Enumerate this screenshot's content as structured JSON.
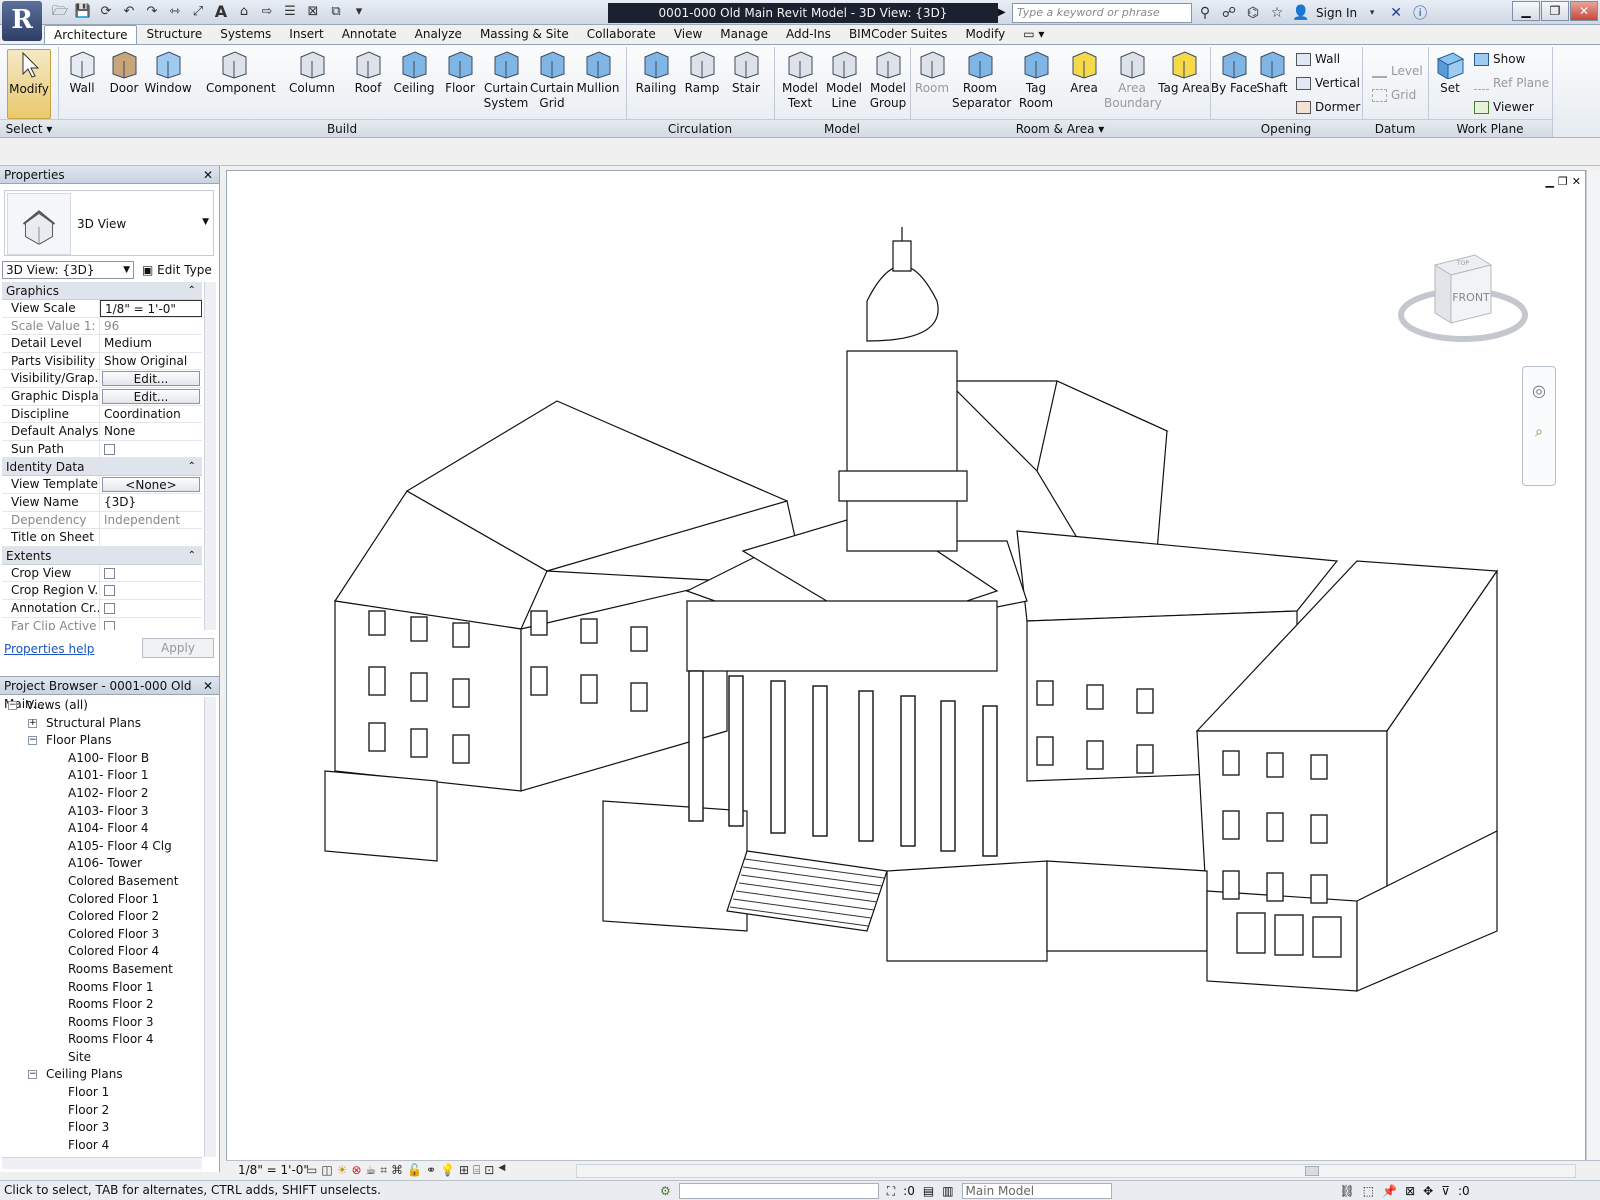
{
  "app": {
    "logo": "R",
    "document_title": "0001-000 Old Main Revit Model - 3D View: {3D}"
  },
  "quick_access": [
    "open-icon",
    "save-icon",
    "sync-icon",
    "undo-icon",
    "redo-icon",
    "measure-icon",
    "dimension-icon",
    "text-icon",
    "3d-view-icon",
    "section-icon",
    "thin-lines-icon",
    "close-hidden-icon",
    "switch-windows-icon"
  ],
  "infocenter": {
    "search_placeholder": "Type a keyword or phrase",
    "sign_in": "Sign In"
  },
  "tabs": [
    "Architecture",
    "Structure",
    "Systems",
    "Insert",
    "Annotate",
    "Analyze",
    "Massing & Site",
    "Collaborate",
    "View",
    "Manage",
    "Add-Ins",
    "BIMCoder Suites",
    "Modify"
  ],
  "active_tab": "Architecture",
  "ribbon": {
    "select": {
      "label": "Modify",
      "panel": "Select"
    },
    "build": {
      "panel": "Build",
      "tools": [
        "Wall",
        "Door",
        "Window",
        "Component",
        "Column",
        "Roof",
        "Ceiling",
        "Floor",
        "Curtain System",
        "Curtain Grid",
        "Mullion"
      ]
    },
    "circulation": {
      "panel": "Circulation",
      "tools": [
        "Railing",
        "Ramp",
        "Stair"
      ]
    },
    "model": {
      "panel": "Model",
      "tools": [
        "Model Text",
        "Model Line",
        "Model Group"
      ]
    },
    "room_area": {
      "panel": "Room & Area",
      "tools": [
        "Room",
        "Room Separator",
        "Tag Room",
        "Area",
        "Area Boundary",
        "Tag Area"
      ]
    },
    "opening": {
      "panel": "Opening",
      "tools": [
        "By Face",
        "Shaft"
      ],
      "small": [
        "Wall",
        "Vertical",
        "Dormer"
      ]
    },
    "datum": {
      "panel": "Datum",
      "small": [
        "Level",
        "Grid"
      ]
    },
    "work_plane": {
      "panel": "Work Plane",
      "tool": "Set",
      "small": [
        "Show",
        "Ref  Plane",
        "Viewer"
      ]
    }
  },
  "properties": {
    "title": "Properties",
    "type_name": "3D View",
    "instance_selector": "3D View: {3D}",
    "edit_type": "Edit Type",
    "groups": [
      {
        "name": "Graphics",
        "rows": [
          {
            "k": "View Scale",
            "v": "1/8\" = 1'-0\"",
            "style": "field"
          },
          {
            "k": "Scale Value    1:",
            "v": "96",
            "style": "ro"
          },
          {
            "k": "Detail Level",
            "v": "Medium"
          },
          {
            "k": "Parts Visibility",
            "v": "Show Original"
          },
          {
            "k": "Visibility/Grap...",
            "v": "Edit...",
            "style": "btn"
          },
          {
            "k": "Graphic Displa...",
            "v": "Edit...",
            "style": "btn"
          },
          {
            "k": "Discipline",
            "v": "Coordination"
          },
          {
            "k": "Default Analys...",
            "v": "None"
          },
          {
            "k": "Sun Path",
            "v": "",
            "style": "check"
          }
        ]
      },
      {
        "name": "Identity Data",
        "rows": [
          {
            "k": "View Template",
            "v": "<None>",
            "style": "btn"
          },
          {
            "k": "View Name",
            "v": "{3D}"
          },
          {
            "k": "Dependency",
            "v": "Independent",
            "style": "ro"
          },
          {
            "k": "Title on Sheet",
            "v": ""
          }
        ]
      },
      {
        "name": "Extents",
        "rows": [
          {
            "k": "Crop View",
            "v": "",
            "style": "check"
          },
          {
            "k": "Crop Region V...",
            "v": "",
            "style": "check"
          },
          {
            "k": "Annotation Cr...",
            "v": "",
            "style": "check"
          },
          {
            "k": "Far Clip Active",
            "v": "",
            "style": "check ro"
          }
        ]
      }
    ],
    "help": "Properties help",
    "apply": "Apply"
  },
  "browser": {
    "title": "Project Browser - 0001-000 Old Main...",
    "nodes": [
      {
        "label": "Views (all)",
        "level": 0,
        "exp": "−"
      },
      {
        "label": "Structural Plans",
        "level": 1,
        "exp": "+"
      },
      {
        "label": "Floor Plans",
        "level": 1,
        "exp": "−"
      },
      {
        "label": "A100- Floor B",
        "level": 2
      },
      {
        "label": "A101- Floor 1",
        "level": 2
      },
      {
        "label": "A102- Floor 2",
        "level": 2
      },
      {
        "label": "A103- Floor 3",
        "level": 2
      },
      {
        "label": "A104- Floor 4",
        "level": 2
      },
      {
        "label": "A105- Floor 4 Clg",
        "level": 2
      },
      {
        "label": "A106- Tower",
        "level": 2
      },
      {
        "label": "Colored Basement",
        "level": 2
      },
      {
        "label": "Colored Floor 1",
        "level": 2
      },
      {
        "label": "Colored Floor 2",
        "level": 2
      },
      {
        "label": "Colored Floor 3",
        "level": 2
      },
      {
        "label": "Colored Floor 4",
        "level": 2
      },
      {
        "label": "Rooms Basement",
        "level": 2
      },
      {
        "label": "Rooms Floor 1",
        "level": 2
      },
      {
        "label": "Rooms Floor 2",
        "level": 2
      },
      {
        "label": "Rooms Floor 3",
        "level": 2
      },
      {
        "label": "Rooms Floor 4",
        "level": 2
      },
      {
        "label": "Site",
        "level": 2
      },
      {
        "label": "Ceiling Plans",
        "level": 1,
        "exp": "−"
      },
      {
        "label": "Floor 1",
        "level": 2
      },
      {
        "label": "Floor 2",
        "level": 2
      },
      {
        "label": "Floor 3",
        "level": 2
      },
      {
        "label": "Floor 4",
        "level": 2
      }
    ]
  },
  "viewcube": {
    "face": "FRONT",
    "top": "TOP"
  },
  "view_control": {
    "scale": "1/8\" = 1'-0\""
  },
  "status": {
    "text": "Click to select, TAB for alternates, CTRL adds, SHIFT unselects.",
    "count": ":0",
    "model": "Main Model",
    "filter": ":0"
  }
}
